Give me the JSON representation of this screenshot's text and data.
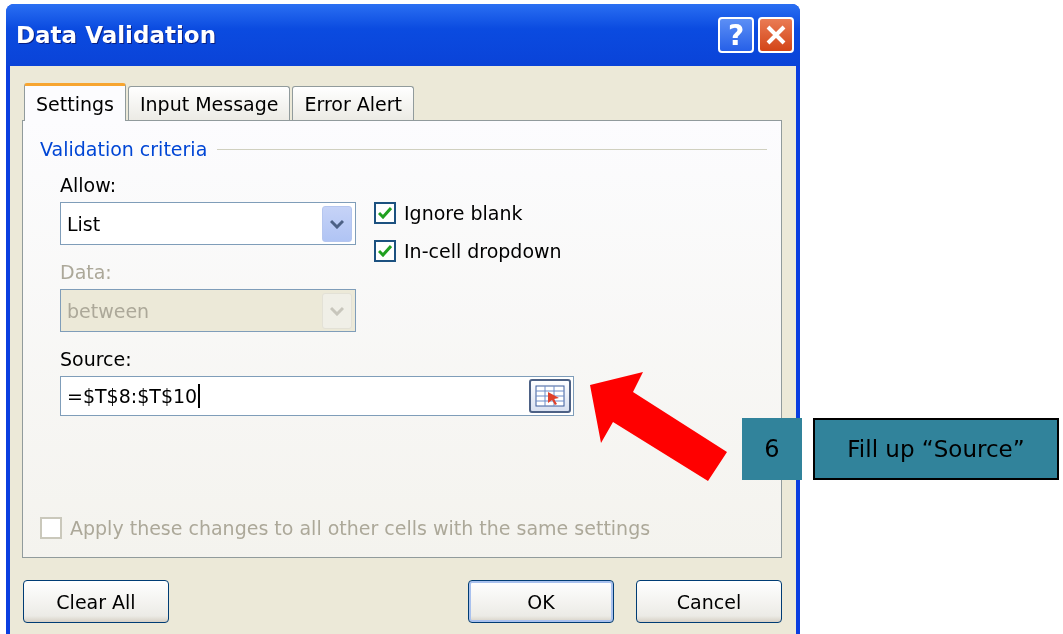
{
  "window": {
    "title": "Data Validation",
    "help_label": "?"
  },
  "tabs": [
    {
      "label": "Settings",
      "selected": true
    },
    {
      "label": "Input Message",
      "selected": false
    },
    {
      "label": "Error Alert",
      "selected": false
    }
  ],
  "section_title": "Validation criteria",
  "allow": {
    "label": "Allow:",
    "value": "List",
    "disabled": false
  },
  "data": {
    "label": "Data:",
    "value": "between",
    "disabled": true
  },
  "checkboxes": [
    {
      "label": "Ignore blank",
      "checked": true,
      "disabled": false
    },
    {
      "label": "In-cell dropdown",
      "checked": true,
      "disabled": false
    }
  ],
  "source": {
    "label": "Source:",
    "value": "=$T$8:$T$10"
  },
  "apply_all": {
    "label": "Apply these changes to all other cells with the same settings",
    "checked": false,
    "disabled": true
  },
  "buttons": [
    {
      "label": "Clear All",
      "default": false
    },
    {
      "label": "OK",
      "default": true
    },
    {
      "label": "Cancel",
      "default": false
    }
  ],
  "callout": {
    "step": "6",
    "text": "Fill up “Source”"
  }
}
